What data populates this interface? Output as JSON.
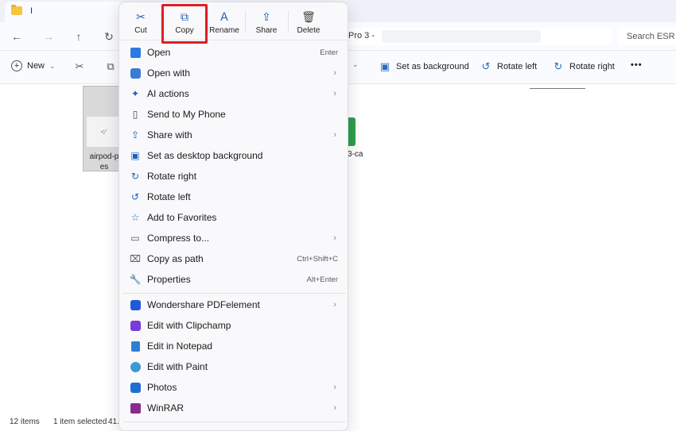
{
  "window": {
    "tab_title": "I"
  },
  "address": {
    "text": "Pro 3 -"
  },
  "search": {
    "placeholder": "Search ESR"
  },
  "cmdbar": {
    "new_label": "New",
    "set_background": "Set as background",
    "rotate_left": "Rotate left",
    "rotate_right": "Rotate right",
    "more": "•••"
  },
  "files": [
    {
      "label": "airpod-p\nes"
    },
    {
      "label": "3-ca"
    }
  ],
  "status": {
    "items": "12 items",
    "selected": "1 item selected",
    "size": "41."
  },
  "quick_actions": [
    {
      "label": "Cut",
      "icon": "cut-icon"
    },
    {
      "label": "Copy",
      "icon": "copy-icon"
    },
    {
      "label": "Rename",
      "icon": "rename-icon"
    },
    {
      "label": "Share",
      "icon": "share-icon"
    },
    {
      "label": "Delete",
      "icon": "delete-icon"
    }
  ],
  "menu": {
    "items": [
      {
        "label": "Open",
        "shortcut": "Enter",
        "icon": "open-icon"
      },
      {
        "label": "Open with",
        "submenu": true,
        "icon": "open-with-icon"
      },
      {
        "label": "AI actions",
        "submenu": true,
        "icon": "ai-actions-icon"
      },
      {
        "label": "Send to My Phone",
        "icon": "phone-icon"
      },
      {
        "label": "Share with",
        "submenu": true,
        "icon": "share-with-icon"
      },
      {
        "label": "Set as desktop background",
        "icon": "desktop-background-icon"
      },
      {
        "label": "Rotate right",
        "icon": "rotate-right-icon"
      },
      {
        "label": "Rotate left",
        "icon": "rotate-left-icon"
      },
      {
        "label": "Add to Favorites",
        "icon": "star-icon"
      },
      {
        "label": "Compress to...",
        "submenu": true,
        "icon": "compress-icon"
      },
      {
        "label": "Copy as path",
        "shortcut": "Ctrl+Shift+C",
        "icon": "copy-path-icon"
      },
      {
        "label": "Properties",
        "shortcut": "Alt+Enter",
        "icon": "properties-icon"
      },
      {
        "label": "Wondershare PDFelement",
        "submenu": true,
        "icon": "pdfelement-icon"
      },
      {
        "label": "Edit with Clipchamp",
        "icon": "clipchamp-icon"
      },
      {
        "label": "Edit in Notepad",
        "icon": "notepad-icon"
      },
      {
        "label": "Edit with Paint",
        "icon": "paint-icon"
      },
      {
        "label": "Photos",
        "submenu": true,
        "icon": "photos-icon"
      },
      {
        "label": "WinRAR",
        "submenu": true,
        "icon": "winrar-icon"
      }
    ]
  },
  "colors": {
    "accent": "#1e62b8",
    "highlight": "#e01e24"
  }
}
